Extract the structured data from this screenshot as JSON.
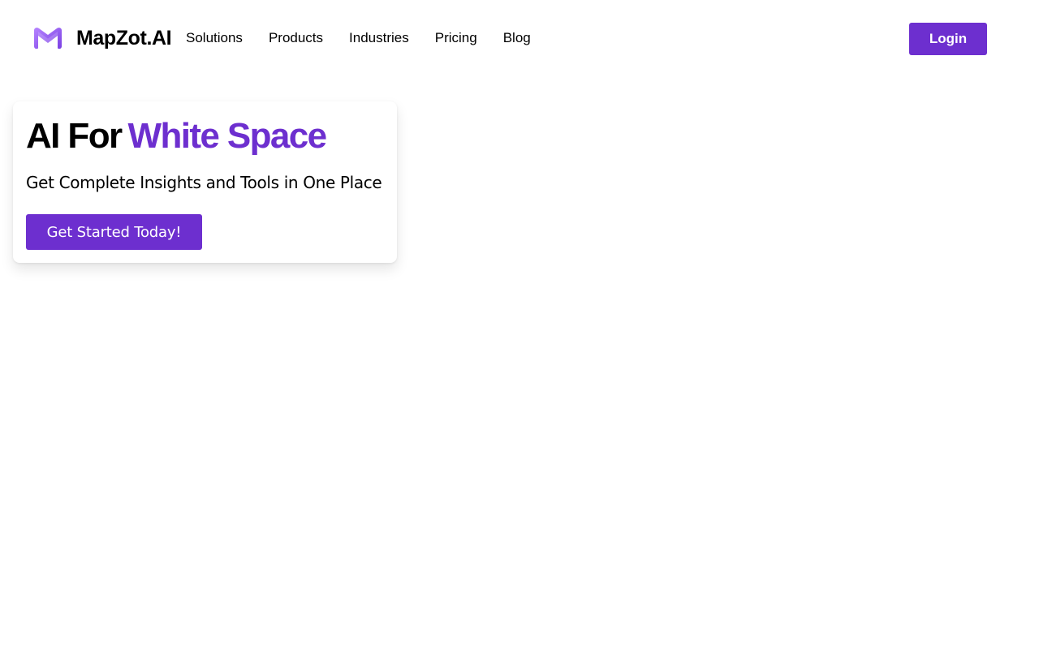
{
  "header": {
    "logo": {
      "icon": "mapzot-m-logo-icon",
      "name": "MapZot.AI",
      "gradient_colors": [
        "#a977ff",
        "#6d2fcf"
      ]
    },
    "nav": [
      {
        "label": "Solutions"
      },
      {
        "label": "Products"
      },
      {
        "label": "Industries"
      },
      {
        "label": "Pricing"
      },
      {
        "label": "Blog"
      }
    ],
    "login_label": "Login"
  },
  "hero": {
    "title_prefix": "AI For",
    "title_highlight": "White Space",
    "subtitle": "Get Complete Insights and Tools in One Place",
    "cta_label": "Get Started Today!"
  },
  "colors": {
    "accent": "#6d2fcf",
    "text": "#000000",
    "background": "#ffffff"
  }
}
